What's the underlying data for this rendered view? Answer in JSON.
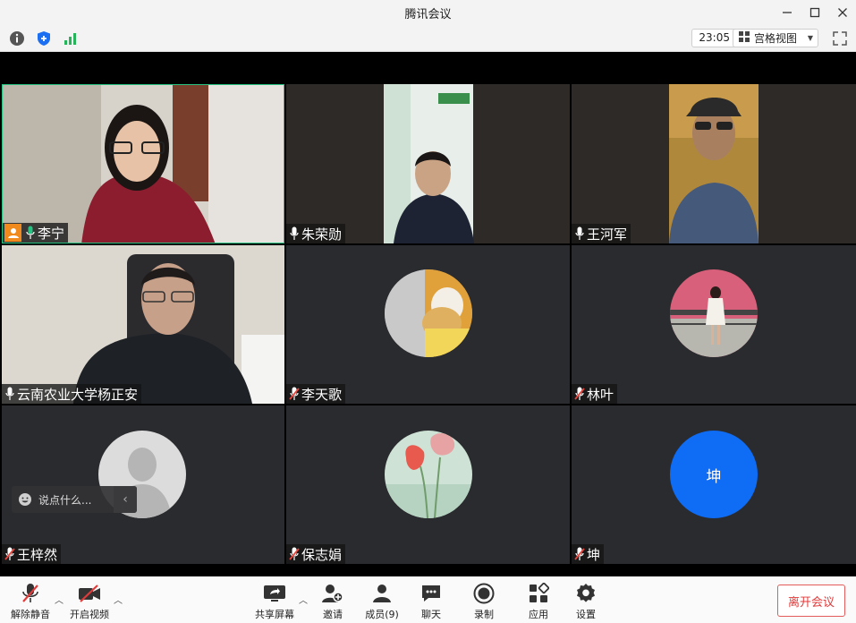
{
  "window": {
    "title": "腾讯会议",
    "minimize_icon": "minimize-icon",
    "maximize_icon": "maximize-icon",
    "close_icon": "close-icon"
  },
  "infobar": {
    "icons": [
      "info-icon",
      "shield-icon",
      "signal-icon"
    ],
    "timer": "23:05",
    "view_mode": "宫格视图",
    "fullscreen_icon": "fullscreen-icon"
  },
  "participants": [
    {
      "name": "李宁",
      "mic": "on",
      "host": true,
      "type": "video",
      "highlight": "#26c281"
    },
    {
      "name": "朱荣勋",
      "mic": "on",
      "type": "video"
    },
    {
      "name": "王河军",
      "mic": "on",
      "type": "video"
    },
    {
      "name": "云南农业大学杨正安",
      "mic": "on",
      "type": "video"
    },
    {
      "name": "李天歌",
      "mic": "muted",
      "type": "avatar"
    },
    {
      "name": "林叶",
      "mic": "muted",
      "type": "avatar"
    },
    {
      "name": "王梓然",
      "mic": "muted",
      "type": "avatar"
    },
    {
      "name": "保志娟",
      "mic": "muted",
      "type": "avatar"
    },
    {
      "name": "坤",
      "mic": "muted",
      "type": "letter",
      "letter": "坤",
      "avatar_color": "#0e6cf5"
    }
  ],
  "chat": {
    "placeholder": "说点什么..."
  },
  "toolbar": {
    "unmute": "解除静音",
    "start_video": "开启视频",
    "share_screen": "共享屏幕",
    "invite": "邀请",
    "members": "成员(9)",
    "chat": "聊天",
    "record": "录制",
    "apps": "应用",
    "settings": "设置",
    "leave": "离开会议"
  },
  "colors": {
    "accent": "#0e6cf5",
    "danger": "#e03b3b",
    "host_badge": "#f08a1c"
  }
}
